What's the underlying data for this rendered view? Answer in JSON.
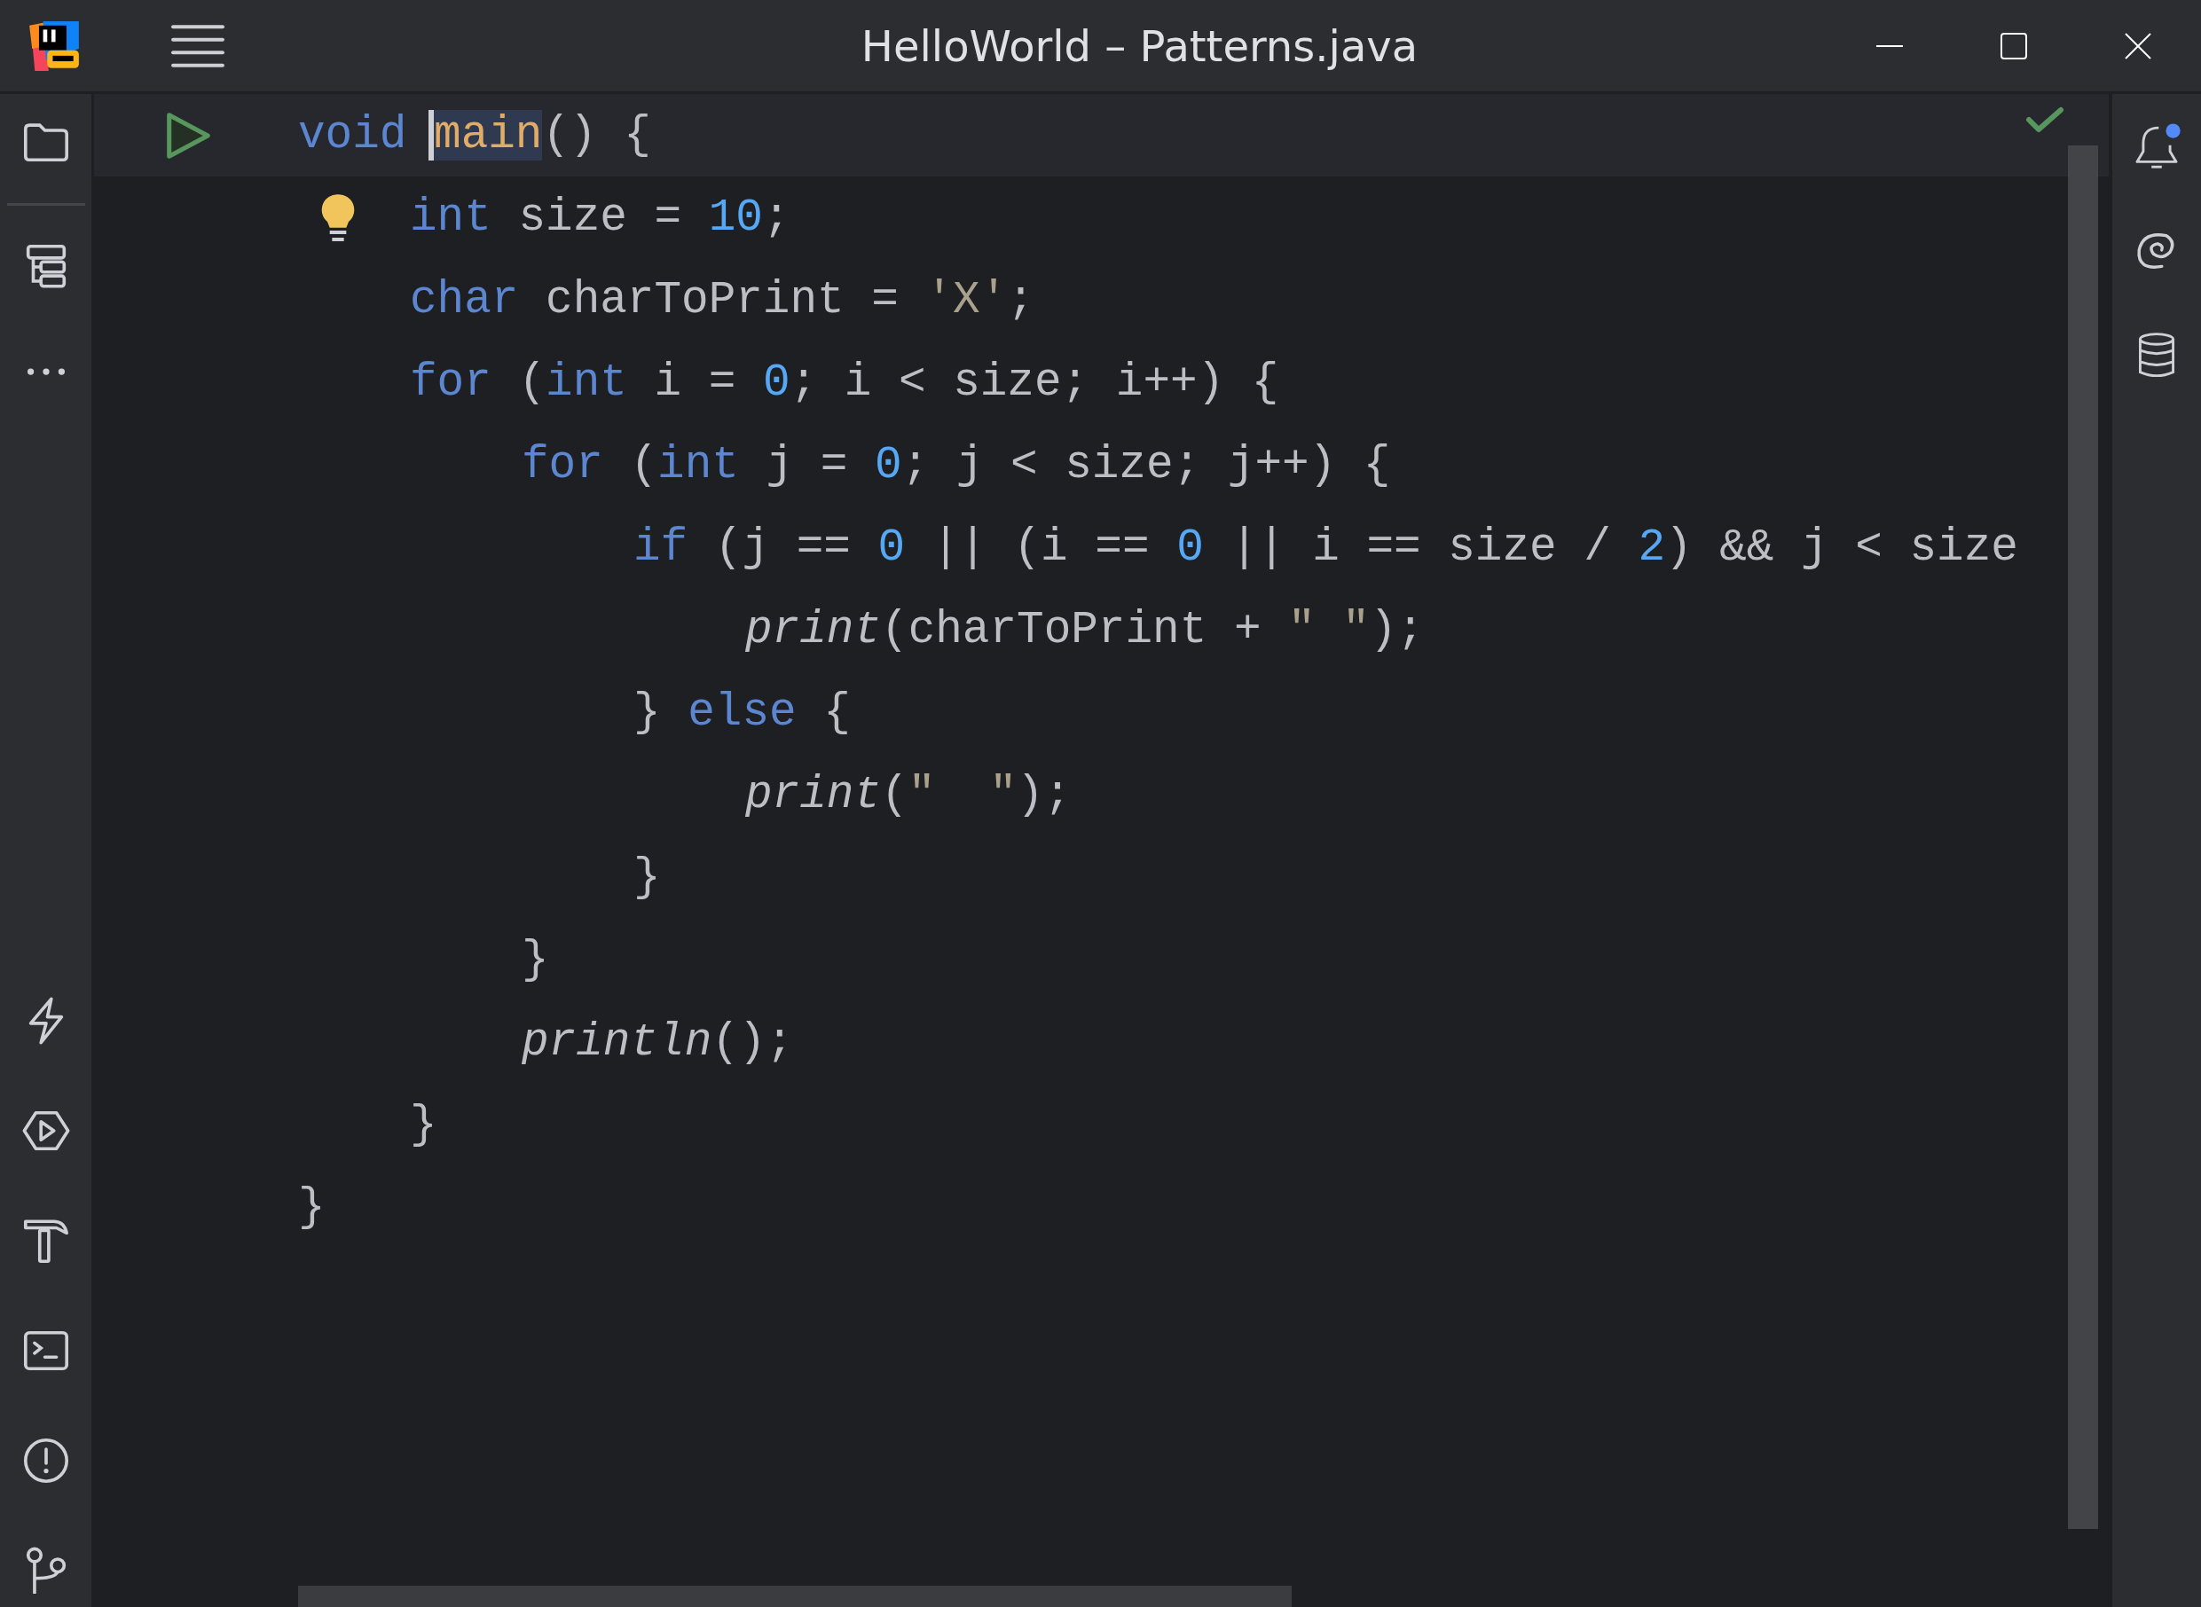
{
  "window": {
    "title": "HelloWorld – Patterns.java"
  },
  "code_lines": [
    {
      "kind": "run_marker",
      "current": true,
      "tokens": [
        {
          "text": "void ",
          "kind": "keyword"
        },
        {
          "text": "main",
          "kind": "method",
          "highlighted": true
        },
        {
          "text": "() {",
          "kind": "plain"
        }
      ],
      "children": [
        {
          "kind": "bulb_marker",
          "current": false,
          "tokens": [
            {
              "text": "int ",
              "kind": "keyword"
            },
            {
              "text": "size = ",
              "kind": "plain"
            },
            {
              "text": "10",
              "kind": "number"
            },
            {
              "text": ";",
              "kind": "plain"
            }
          ]
        },
        {
          "current": false,
          "tokens": [
            {
              "text": "char ",
              "kind": "keyword"
            },
            {
              "text": "charToPrint = ",
              "kind": "plain"
            },
            {
              "text": "'X'",
              "kind": "string"
            },
            {
              "text": ";",
              "kind": "plain"
            }
          ]
        },
        {
          "current": false,
          "tokens": [
            {
              "text": "for",
              "kind": "keyword"
            },
            {
              "text": " (",
              "kind": "plain"
            },
            {
              "text": "int",
              "kind": "keyword"
            },
            {
              "text": " i = ",
              "kind": "plain"
            },
            {
              "text": "0",
              "kind": "number"
            },
            {
              "text": "; i < size; i++) {",
              "kind": "plain"
            }
          ],
          "children": [
            {
              "current": false,
              "tokens": [
                {
                  "text": "for",
                  "kind": "keyword"
                },
                {
                  "text": " (",
                  "kind": "plain"
                },
                {
                  "text": "int",
                  "kind": "keyword"
                },
                {
                  "text": " j = ",
                  "kind": "plain"
                },
                {
                  "text": "0",
                  "kind": "number"
                },
                {
                  "text": "; j < size; j++) {",
                  "kind": "plain"
                }
              ],
              "children": [
                {
                  "current": false,
                  "tokens": [
                    {
                      "text": "if",
                      "kind": "keyword"
                    },
                    {
                      "text": " (j == ",
                      "kind": "plain"
                    },
                    {
                      "text": "0",
                      "kind": "number"
                    },
                    {
                      "text": " || (i == ",
                      "kind": "plain"
                    },
                    {
                      "text": "0",
                      "kind": "number"
                    },
                    {
                      "text": " || i == size / ",
                      "kind": "plain"
                    },
                    {
                      "text": "2",
                      "kind": "number"
                    },
                    {
                      "text": ") && j < size",
                      "kind": "plain"
                    }
                  ],
                  "children": [
                    {
                      "current": false,
                      "tokens": [
                        {
                          "text": "print",
                          "kind": "call"
                        },
                        {
                          "text": "(charToPrint + ",
                          "kind": "plain"
                        },
                        {
                          "text": "\" \"",
                          "kind": "string"
                        },
                        {
                          "text": ");",
                          "kind": "plain"
                        }
                      ]
                    }
                  ]
                },
                {
                  "current": false,
                  "tokens": [
                    {
                      "text": "} ",
                      "kind": "plain"
                    },
                    {
                      "text": "else",
                      "kind": "keyword"
                    },
                    {
                      "text": " {",
                      "kind": "plain"
                    }
                  ],
                  "children": [
                    {
                      "current": false,
                      "tokens": [
                        {
                          "text": "print",
                          "kind": "call"
                        },
                        {
                          "text": "(",
                          "kind": "plain"
                        },
                        {
                          "text": "\"  \"",
                          "kind": "string"
                        },
                        {
                          "text": ");",
                          "kind": "plain"
                        }
                      ]
                    }
                  ]
                },
                {
                  "current": false,
                  "tokens": [
                    {
                      "text": "}",
                      "kind": "plain"
                    }
                  ]
                }
              ]
            },
            {
              "current": false,
              "tokens": [
                {
                  "text": "}",
                  "kind": "plain"
                }
              ]
            },
            {
              "current": false,
              "tokens": [
                {
                  "text": "println",
                  "kind": "call"
                },
                {
                  "text": "();",
                  "kind": "plain"
                }
              ]
            }
          ]
        },
        {
          "current": false,
          "tokens": [
            {
              "text": "}",
              "kind": "plain"
            }
          ]
        }
      ]
    },
    {
      "current": false,
      "tokens": [
        {
          "text": "}",
          "kind": "plain"
        }
      ]
    }
  ]
}
